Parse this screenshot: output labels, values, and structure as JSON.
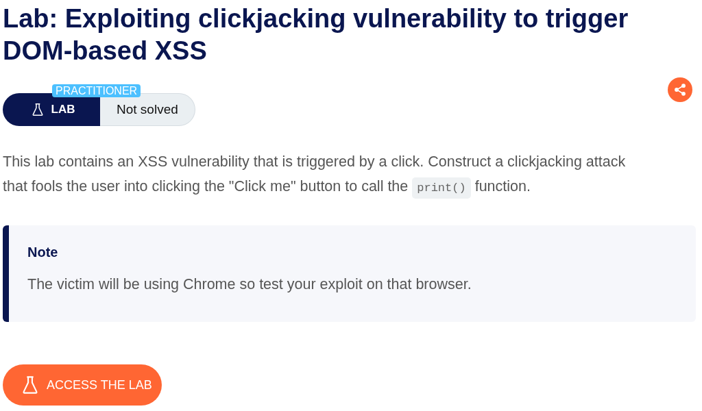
{
  "title": "Lab: Exploiting clickjacking vulnerability to trigger DOM-based XSS",
  "level_badge": "PRACTITIONER",
  "lab_tag": "LAB",
  "status": {
    "label": "Not solved",
    "solved": false
  },
  "description": {
    "before": "This lab contains an XSS vulnerability that is triggered by a click. Construct a clickjacking attack that fools the user into clicking the \"Click me\" button to call the ",
    "code": "print()",
    "after": " function."
  },
  "note": {
    "heading": "Note",
    "text": "The victim will be using Chrome so test your exploit on that browser."
  },
  "access_button": "ACCESS THE LAB"
}
